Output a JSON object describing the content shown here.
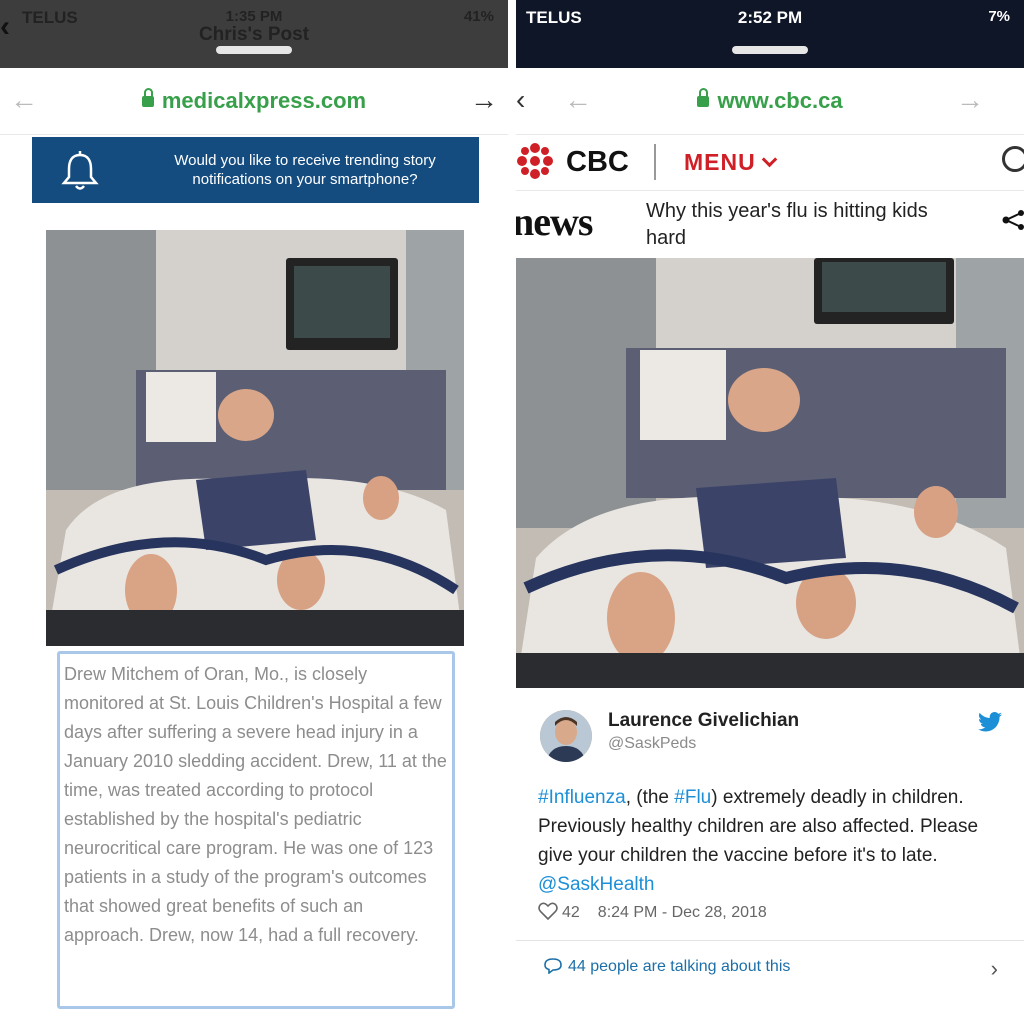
{
  "left": {
    "status": {
      "carrier": "TELUS",
      "time": "1:35 PM",
      "subtitle": "Chris's Post",
      "battery": "41%"
    },
    "url": "medicalxpress.com",
    "notification": "Would you like to receive trending story notifications on your smartphone?",
    "caption": "Drew Mitchem of Oran, Mo., is closely monitored at St. Louis Children's Hospital a few days after suffering a severe head injury in a January 2010 sledding accident. Drew, 11 at the time, was treated according to protocol established by the hospital's pediatric neurocritical care program. He was one of 123 patients in a study of the program's outcomes that showed great benefits of such an approach. Drew, now 14, had a full recovery."
  },
  "right": {
    "status": {
      "carrier": "TELUS",
      "time": "2:52 PM",
      "battery": "7%"
    },
    "url": "www.cbc.ca",
    "cbc": {
      "brand": "CBC",
      "menu": "MENU",
      "section": "news",
      "headline": "Why this year's flu is hitting kids hard"
    },
    "tweet": {
      "name": "Laurence Givelichian",
      "handle": "@SaskPeds",
      "tag1": "#Influenza",
      "text1": ", (the ",
      "tag2": "#Flu",
      "text2": ") extremely  deadly in children. Previously healthy children are also affected. Please give your children the vaccine before it's to late. ",
      "mention": "@SaskHealth",
      "likes": "42",
      "timestamp": "8:24 PM - Dec 28, 2018",
      "talking": "44 people are talking about this"
    }
  },
  "colors": {
    "url_green": "#38a04a",
    "banner_blue": "#154c80",
    "cbc_red": "#cf2027",
    "twitter_blue": "#1d8fd6"
  },
  "icons": [
    "back-chevron-icon",
    "lock-icon",
    "bell-icon",
    "cbc-gem-icon",
    "search-icon",
    "share-icon",
    "twitter-bird-icon",
    "heart-icon",
    "speech-bubble-icon",
    "chevron-right-icon"
  ]
}
